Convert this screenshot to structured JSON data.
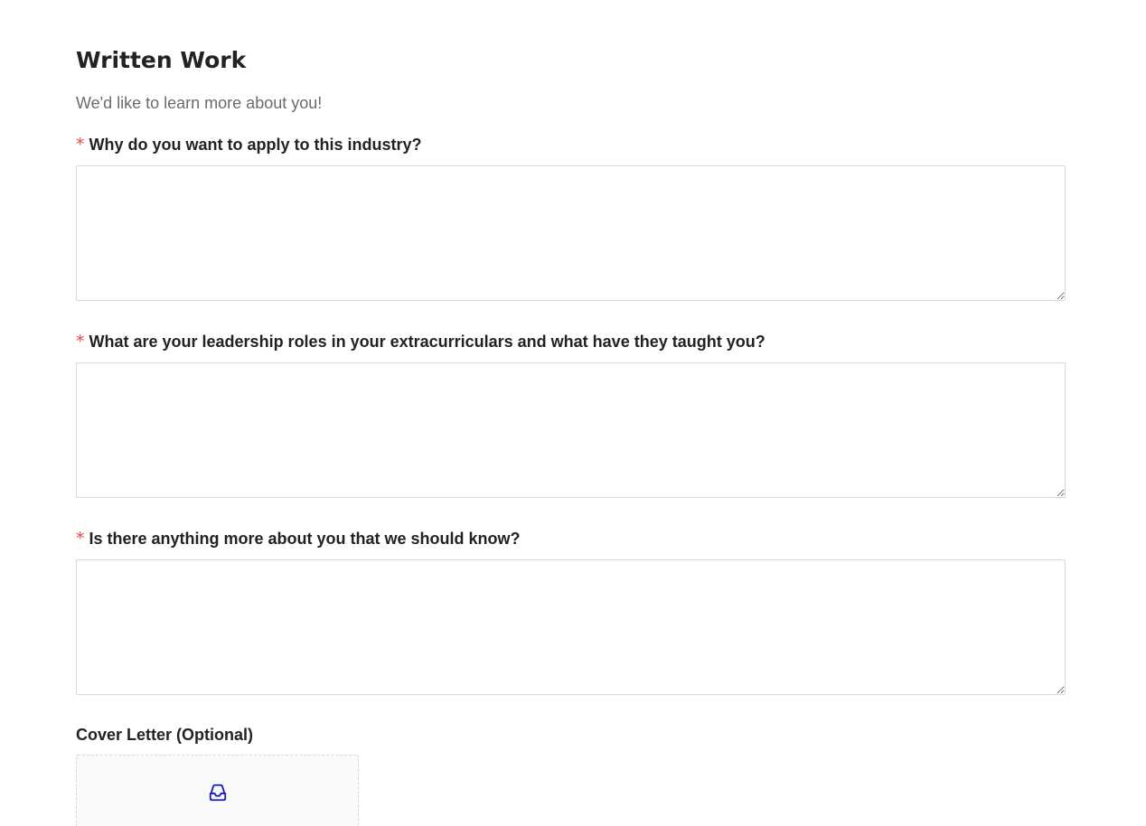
{
  "section": {
    "title": "Written Work",
    "description": "We'd like to learn more about you!"
  },
  "questions": [
    {
      "required_mark": "*",
      "label": "Why do you want to apply to this industry?",
      "value": ""
    },
    {
      "required_mark": "*",
      "label": "What are your leadership roles in your extracurriculars and what have they taught you?",
      "value": ""
    },
    {
      "required_mark": "*",
      "label": "Is there anything more about you that we should know?",
      "value": ""
    }
  ],
  "cover_letter": {
    "label": "Cover Letter (Optional)",
    "icon": "inbox-icon"
  },
  "colors": {
    "required": "#e0474c",
    "upload_icon": "#1a1ab8",
    "border": "#d9d9d9"
  }
}
